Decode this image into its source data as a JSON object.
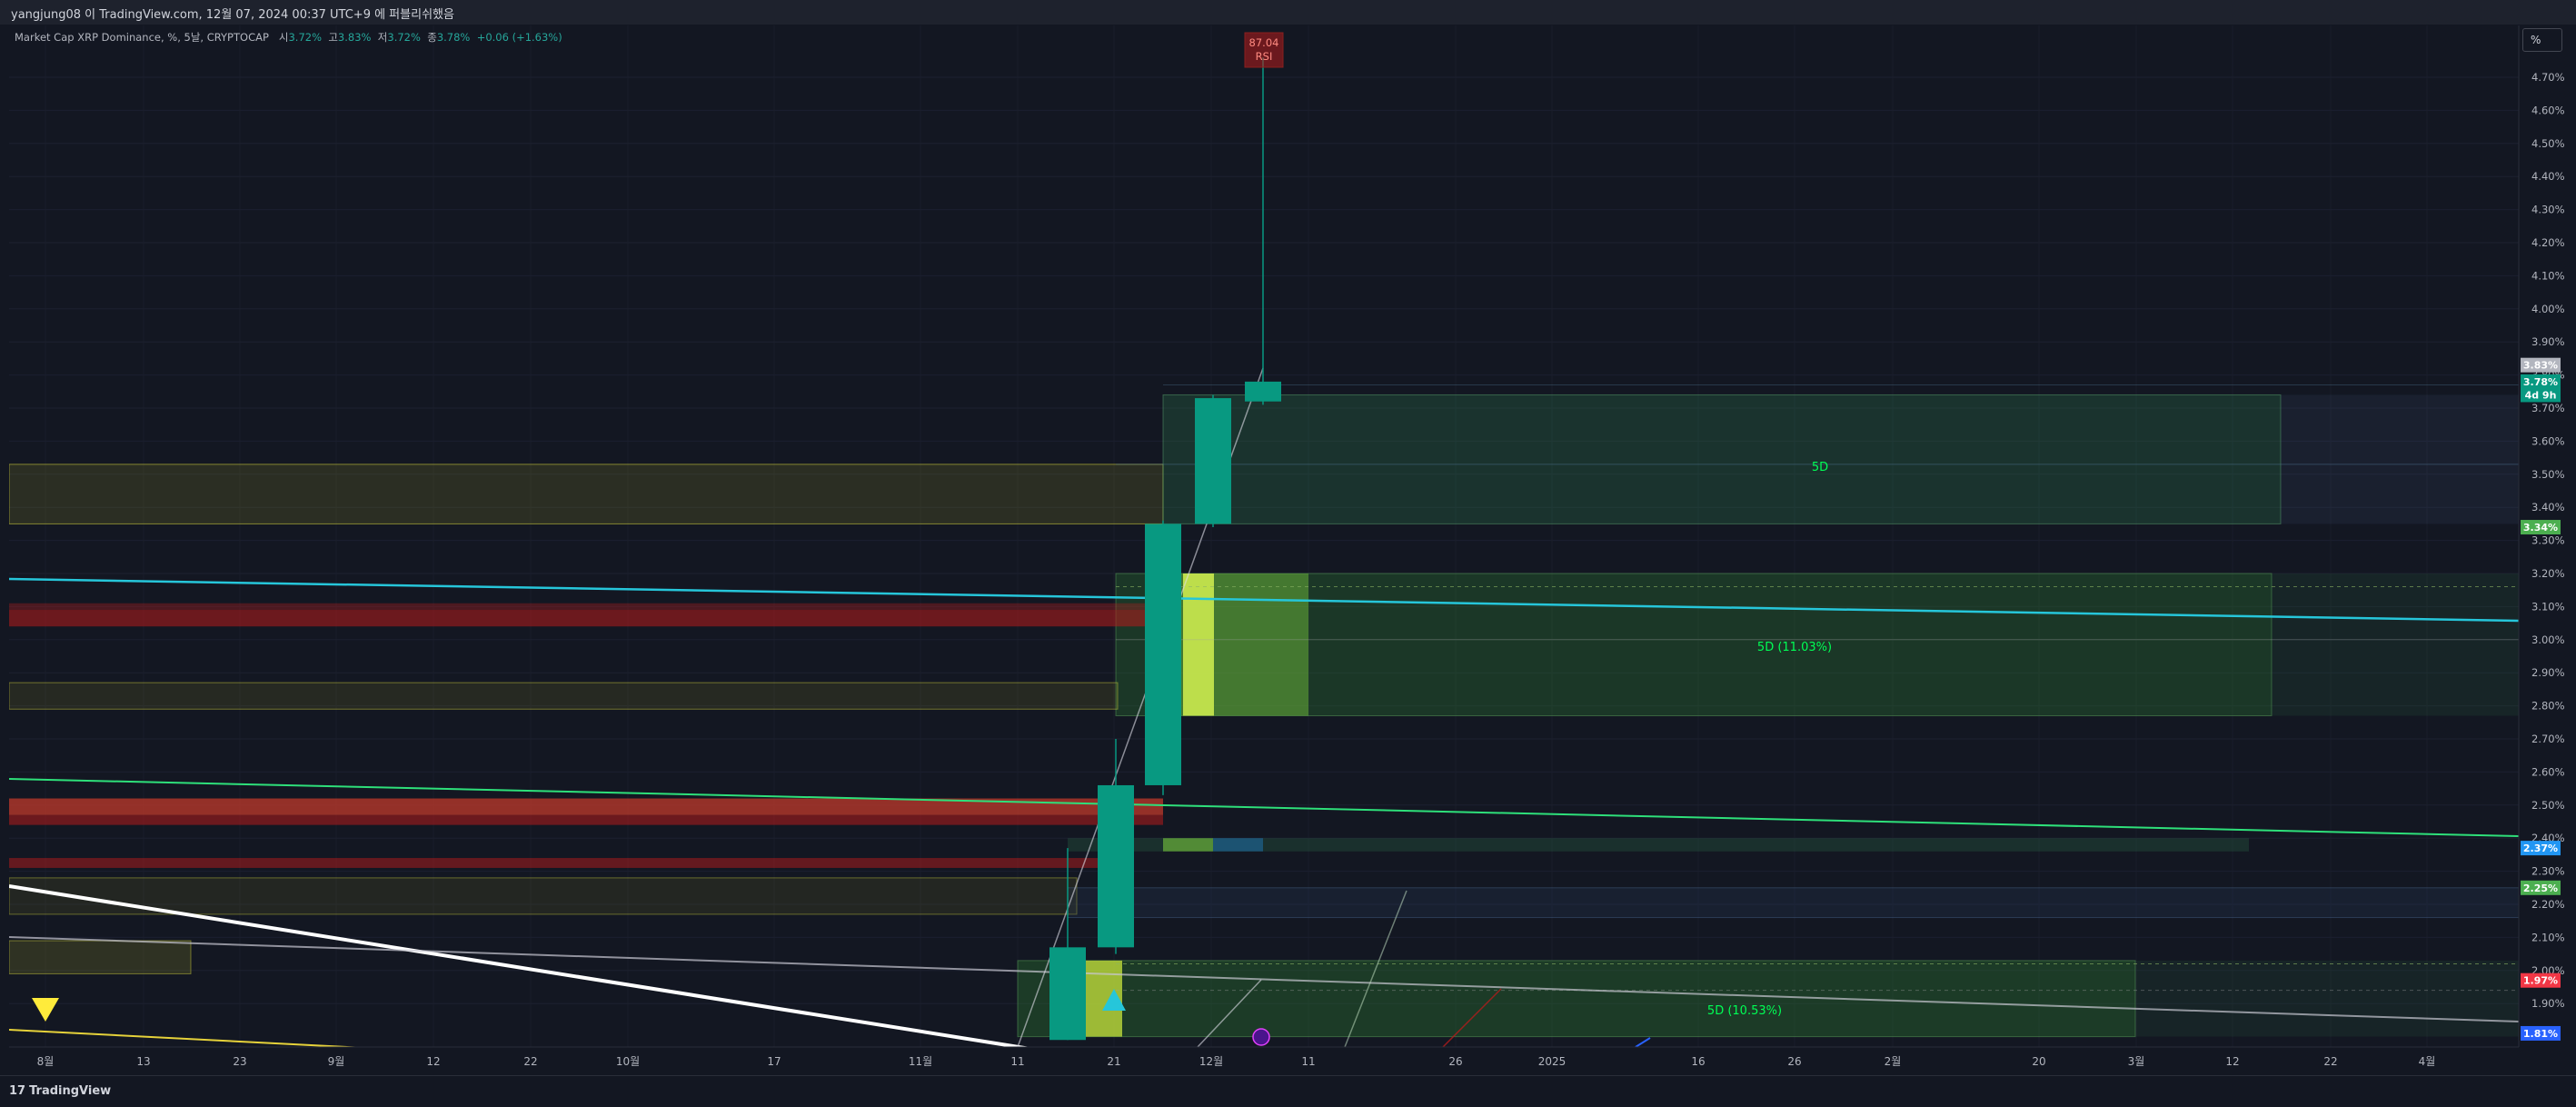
{
  "header": {
    "snapshot_text": "yangjung08 이 TradingView.com, 12월 07, 2024 00:37 UTC+9 에 퍼블리쉬했음"
  },
  "legend": {
    "symbol": "Market Cap XRP Dominance, %, 5날, CRYPTOCAP",
    "open_label": "시",
    "open": "3.72%",
    "high_label": "고",
    "high": "3.83%",
    "low_label": "저",
    "low": "3.72%",
    "close_label": "종",
    "close": "3.78%",
    "change": "+0.06 (+1.63%)"
  },
  "toolbar": {
    "percent_button": "%"
  },
  "footer": {
    "logo_text": "TradingView",
    "logo_mark": "17"
  },
  "colors": {
    "background": "#131722",
    "up_candle": "#089981",
    "cyan_line": "#26c6da",
    "green_line": "#2ee07a",
    "zone_green": "#2e7d32",
    "zone_red": "#b71c1c",
    "zone_orange": "#c0392b",
    "zone_yellow": "#8d8d2a",
    "label_green": "#00ff55"
  },
  "chart_data": {
    "type": "candlestick",
    "y_axis": {
      "min": 1.8,
      "max": 4.75,
      "scale": "linear",
      "unit": "%",
      "ticks": [
        "1.90%",
        "2.00%",
        "2.10%",
        "2.20%",
        "2.30%",
        "2.40%",
        "2.50%",
        "2.60%",
        "2.70%",
        "2.80%",
        "2.90%",
        "3.00%",
        "3.10%",
        "3.20%",
        "3.30%",
        "3.40%",
        "3.50%",
        "3.60%",
        "3.70%",
        "3.80%",
        "3.90%",
        "4.00%",
        "4.10%",
        "4.20%",
        "4.30%",
        "4.40%",
        "4.50%",
        "4.60%",
        "4.70%"
      ]
    },
    "x_axis": {
      "ticks": [
        "8월",
        "13",
        "23",
        "9월",
        "12",
        "22",
        "10월",
        "17",
        "11월",
        "11",
        "21",
        "12월",
        "11",
        "26",
        "2025",
        "16",
        "26",
        "2월",
        "20",
        "3월",
        "12",
        "22",
        "4월"
      ]
    },
    "candles": [
      {
        "label": "11월 11",
        "open": 1.79,
        "high": 2.37,
        "low": 1.79,
        "close": 2.07
      },
      {
        "label": "11월 16",
        "open": 2.07,
        "high": 2.7,
        "low": 2.05,
        "close": 2.56
      },
      {
        "label": "11월 21",
        "open": 2.56,
        "high": 3.36,
        "low": 2.53,
        "close": 3.35
      },
      {
        "label": "11월 26",
        "open": 3.35,
        "high": 3.74,
        "low": 3.34,
        "close": 3.73
      },
      {
        "label": "12월 01",
        "open": 3.72,
        "high": 4.76,
        "low": 3.71,
        "close": 3.78
      }
    ],
    "price_labels": [
      {
        "text": "3.83%",
        "value": 3.83,
        "color": "#b2b5be"
      },
      {
        "text": "3.78%",
        "value": 3.78,
        "color": "#089981"
      },
      {
        "text": "4d 9h",
        "value": 3.74,
        "color": "#089981"
      },
      {
        "text": "3.34%",
        "value": 3.34,
        "color": "#4caf50"
      },
      {
        "text": "2.37%",
        "value": 2.37,
        "color": "#2196f3"
      },
      {
        "text": "2.25%",
        "value": 2.25,
        "color": "#4caf50"
      },
      {
        "text": "1.97%",
        "value": 1.97,
        "color": "#f23645"
      },
      {
        "text": "1.81%",
        "value": 1.81,
        "color": "#2962ff"
      }
    ],
    "annotations": [
      {
        "text": "87.04",
        "value": 4.76
      },
      {
        "text": "RSI",
        "value": 4.71
      },
      {
        "text": "5D",
        "value": 3.54
      },
      {
        "text": "5D (11.03%)",
        "value": 2.99
      },
      {
        "text": "5D (10.53%)",
        "value": 1.88
      }
    ]
  }
}
